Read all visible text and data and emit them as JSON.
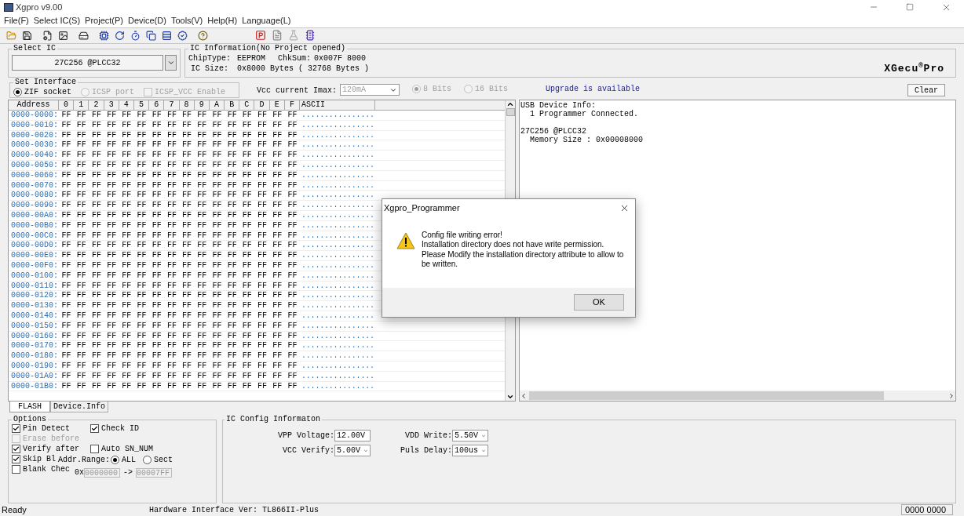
{
  "window": {
    "title": "Xgpro v9.00"
  },
  "menu": [
    "File(F)",
    "Select IC(S)",
    "Project(P)",
    "Device(D)",
    "Tools(V)",
    "Help(H)",
    "Language(L)"
  ],
  "select_ic": {
    "title": "Select IC",
    "value": "27C256 @PLCC32"
  },
  "ic_information": {
    "title": "IC Information(No Project opened)",
    "chip_type_label": "ChipType:",
    "chip_type": "EEPROM",
    "checksum_label": "ChkSum:",
    "checksum": "0x007F 8000",
    "ic_size_label": "IC Size:",
    "ic_size": "0x8000 Bytes ( 32768 Bytes )"
  },
  "logo": {
    "name": "XGecu",
    "mark": "®",
    "suffix": "Pro"
  },
  "set_interface": {
    "title": "Set Interface",
    "ports": [
      {
        "label": "ZIF socket",
        "selected": true,
        "disabled": false
      },
      {
        "label": "ICSP port",
        "selected": false,
        "disabled": true
      }
    ],
    "vcc_enable": {
      "label": "ICSP_VCC Enable",
      "checked": false,
      "disabled": true
    }
  },
  "vcc_current": {
    "label": "Vcc current Imax:",
    "value": "120mA",
    "disabled": true
  },
  "bits": [
    {
      "label": "8 Bits",
      "selected": true,
      "disabled": true
    },
    {
      "label": "16 Bits",
      "selected": false,
      "disabled": true
    }
  ],
  "upgrade_notice": "Upgrade is available",
  "clear_button": "Clear",
  "hex_table": {
    "columns": [
      "Address",
      "0",
      "1",
      "2",
      "3",
      "4",
      "5",
      "6",
      "7",
      "8",
      "9",
      "A",
      "B",
      "C",
      "D",
      "E",
      "F",
      "ASCII"
    ],
    "rows": [
      {
        "address": "0000-0000:",
        "bytes": [
          "FF",
          "FF",
          "FF",
          "FF",
          "FF",
          "FF",
          "FF",
          "FF",
          "FF",
          "FF",
          "FF",
          "FF",
          "FF",
          "FF",
          "FF",
          "FF"
        ],
        "ascii": "................"
      },
      {
        "address": "0000-0010:",
        "bytes": [
          "FF",
          "FF",
          "FF",
          "FF",
          "FF",
          "FF",
          "FF",
          "FF",
          "FF",
          "FF",
          "FF",
          "FF",
          "FF",
          "FF",
          "FF",
          "FF"
        ],
        "ascii": "................"
      },
      {
        "address": "0000-0020:",
        "bytes": [
          "FF",
          "FF",
          "FF",
          "FF",
          "FF",
          "FF",
          "FF",
          "FF",
          "FF",
          "FF",
          "FF",
          "FF",
          "FF",
          "FF",
          "FF",
          "FF"
        ],
        "ascii": "................"
      },
      {
        "address": "0000-0030:",
        "bytes": [
          "FF",
          "FF",
          "FF",
          "FF",
          "FF",
          "FF",
          "FF",
          "FF",
          "FF",
          "FF",
          "FF",
          "FF",
          "FF",
          "FF",
          "FF",
          "FF"
        ],
        "ascii": "................"
      },
      {
        "address": "0000-0040:",
        "bytes": [
          "FF",
          "FF",
          "FF",
          "FF",
          "FF",
          "FF",
          "FF",
          "FF",
          "FF",
          "FF",
          "FF",
          "FF",
          "FF",
          "FF",
          "FF",
          "FF"
        ],
        "ascii": "................"
      },
      {
        "address": "0000-0050:",
        "bytes": [
          "FF",
          "FF",
          "FF",
          "FF",
          "FF",
          "FF",
          "FF",
          "FF",
          "FF",
          "FF",
          "FF",
          "FF",
          "FF",
          "FF",
          "FF",
          "FF"
        ],
        "ascii": "................"
      },
      {
        "address": "0000-0060:",
        "bytes": [
          "FF",
          "FF",
          "FF",
          "FF",
          "FF",
          "FF",
          "FF",
          "FF",
          "FF",
          "FF",
          "FF",
          "FF",
          "FF",
          "FF",
          "FF",
          "FF"
        ],
        "ascii": "................"
      },
      {
        "address": "0000-0070:",
        "bytes": [
          "FF",
          "FF",
          "FF",
          "FF",
          "FF",
          "FF",
          "FF",
          "FF",
          "FF",
          "FF",
          "FF",
          "FF",
          "FF",
          "FF",
          "FF",
          "FF"
        ],
        "ascii": "................"
      },
      {
        "address": "0000-0080:",
        "bytes": [
          "FF",
          "FF",
          "FF",
          "FF",
          "FF",
          "FF",
          "FF",
          "FF",
          "FF",
          "FF",
          "FF",
          "FF",
          "FF",
          "FF",
          "FF",
          "FF"
        ],
        "ascii": "................"
      },
      {
        "address": "0000-0090:",
        "bytes": [
          "FF",
          "FF",
          "FF",
          "FF",
          "FF",
          "FF",
          "FF",
          "FF",
          "FF",
          "FF",
          "FF",
          "FF",
          "FF",
          "FF",
          "FF",
          "FF"
        ],
        "ascii": "................"
      },
      {
        "address": "0000-00A0:",
        "bytes": [
          "FF",
          "FF",
          "FF",
          "FF",
          "FF",
          "FF",
          "FF",
          "FF",
          "FF",
          "FF",
          "FF",
          "FF",
          "FF",
          "FF",
          "FF",
          "FF"
        ],
        "ascii": "................"
      },
      {
        "address": "0000-00B0:",
        "bytes": [
          "FF",
          "FF",
          "FF",
          "FF",
          "FF",
          "FF",
          "FF",
          "FF",
          "FF",
          "FF",
          "FF",
          "FF",
          "FF",
          "FF",
          "FF",
          "FF"
        ],
        "ascii": "................"
      },
      {
        "address": "0000-00C0:",
        "bytes": [
          "FF",
          "FF",
          "FF",
          "FF",
          "FF",
          "FF",
          "FF",
          "FF",
          "FF",
          "FF",
          "FF",
          "FF",
          "FF",
          "FF",
          "FF",
          "FF"
        ],
        "ascii": "................"
      },
      {
        "address": "0000-00D0:",
        "bytes": [
          "FF",
          "FF",
          "FF",
          "FF",
          "FF",
          "FF",
          "FF",
          "FF",
          "FF",
          "FF",
          "FF",
          "FF",
          "FF",
          "FF",
          "FF",
          "FF"
        ],
        "ascii": "................"
      },
      {
        "address": "0000-00E0:",
        "bytes": [
          "FF",
          "FF",
          "FF",
          "FF",
          "FF",
          "FF",
          "FF",
          "FF",
          "FF",
          "FF",
          "FF",
          "FF",
          "FF",
          "FF",
          "FF",
          "FF"
        ],
        "ascii": "................"
      },
      {
        "address": "0000-00F0:",
        "bytes": [
          "FF",
          "FF",
          "FF",
          "FF",
          "FF",
          "FF",
          "FF",
          "FF",
          "FF",
          "FF",
          "FF",
          "FF",
          "FF",
          "FF",
          "FF",
          "FF"
        ],
        "ascii": "................"
      },
      {
        "address": "0000-0100:",
        "bytes": [
          "FF",
          "FF",
          "FF",
          "FF",
          "FF",
          "FF",
          "FF",
          "FF",
          "FF",
          "FF",
          "FF",
          "FF",
          "FF",
          "FF",
          "FF",
          "FF"
        ],
        "ascii": "................"
      },
      {
        "address": "0000-0110:",
        "bytes": [
          "FF",
          "FF",
          "FF",
          "FF",
          "FF",
          "FF",
          "FF",
          "FF",
          "FF",
          "FF",
          "FF",
          "FF",
          "FF",
          "FF",
          "FF",
          "FF"
        ],
        "ascii": "................"
      },
      {
        "address": "0000-0120:",
        "bytes": [
          "FF",
          "FF",
          "FF",
          "FF",
          "FF",
          "FF",
          "FF",
          "FF",
          "FF",
          "FF",
          "FF",
          "FF",
          "FF",
          "FF",
          "FF",
          "FF"
        ],
        "ascii": "................"
      },
      {
        "address": "0000-0130:",
        "bytes": [
          "FF",
          "FF",
          "FF",
          "FF",
          "FF",
          "FF",
          "FF",
          "FF",
          "FF",
          "FF",
          "FF",
          "FF",
          "FF",
          "FF",
          "FF",
          "FF"
        ],
        "ascii": "................"
      },
      {
        "address": "0000-0140:",
        "bytes": [
          "FF",
          "FF",
          "FF",
          "FF",
          "FF",
          "FF",
          "FF",
          "FF",
          "FF",
          "FF",
          "FF",
          "FF",
          "FF",
          "FF",
          "FF",
          "FF"
        ],
        "ascii": "................"
      },
      {
        "address": "0000-0150:",
        "bytes": [
          "FF",
          "FF",
          "FF",
          "FF",
          "FF",
          "FF",
          "FF",
          "FF",
          "FF",
          "FF",
          "FF",
          "FF",
          "FF",
          "FF",
          "FF",
          "FF"
        ],
        "ascii": "................"
      },
      {
        "address": "0000-0160:",
        "bytes": [
          "FF",
          "FF",
          "FF",
          "FF",
          "FF",
          "FF",
          "FF",
          "FF",
          "FF",
          "FF",
          "FF",
          "FF",
          "FF",
          "FF",
          "FF",
          "FF"
        ],
        "ascii": "................"
      },
      {
        "address": "0000-0170:",
        "bytes": [
          "FF",
          "FF",
          "FF",
          "FF",
          "FF",
          "FF",
          "FF",
          "FF",
          "FF",
          "FF",
          "FF",
          "FF",
          "FF",
          "FF",
          "FF",
          "FF"
        ],
        "ascii": "................"
      },
      {
        "address": "0000-0180:",
        "bytes": [
          "FF",
          "FF",
          "FF",
          "FF",
          "FF",
          "FF",
          "FF",
          "FF",
          "FF",
          "FF",
          "FF",
          "FF",
          "FF",
          "FF",
          "FF",
          "FF"
        ],
        "ascii": "................"
      },
      {
        "address": "0000-0190:",
        "bytes": [
          "FF",
          "FF",
          "FF",
          "FF",
          "FF",
          "FF",
          "FF",
          "FF",
          "FF",
          "FF",
          "FF",
          "FF",
          "FF",
          "FF",
          "FF",
          "FF"
        ],
        "ascii": "................"
      },
      {
        "address": "0000-01A0:",
        "bytes": [
          "FF",
          "FF",
          "FF",
          "FF",
          "FF",
          "FF",
          "FF",
          "FF",
          "FF",
          "FF",
          "FF",
          "FF",
          "FF",
          "FF",
          "FF",
          "FF"
        ],
        "ascii": "................"
      },
      {
        "address": "0000-01B0:",
        "bytes": [
          "FF",
          "FF",
          "FF",
          "FF",
          "FF",
          "FF",
          "FF",
          "FF",
          "FF",
          "FF",
          "FF",
          "FF",
          "FF",
          "FF",
          "FF",
          "FF"
        ],
        "ascii": "................"
      }
    ]
  },
  "log": [
    {
      "text": "USB Device Info:",
      "children": [
        {
          "text": "1  Programmer Connected."
        }
      ]
    },
    {
      "text": "27C256 @PLCC32",
      "children": [
        {
          "text": "Memory Size : 0x00008000"
        }
      ]
    }
  ],
  "bottom_tabs": [
    {
      "label": "FLASH",
      "selected": true
    },
    {
      "label": "Device.Info",
      "selected": false
    }
  ],
  "options": {
    "title": "Options",
    "left": [
      {
        "label": "Pin Detect",
        "checked": true,
        "disabled": false
      },
      {
        "label": "Erase before",
        "checked": false,
        "disabled": true
      },
      {
        "label": "Verify after",
        "checked": true,
        "disabled": false
      },
      {
        "label": "Skip Bl",
        "checked": true,
        "disabled": false
      },
      {
        "label": "Blank Chec",
        "checked": false,
        "disabled": false
      }
    ],
    "right": [
      {
        "label": "Check ID",
        "checked": true,
        "disabled": false
      },
      {
        "label": "Auto SN_NUM",
        "checked": false,
        "disabled": false
      }
    ],
    "addr_range": {
      "label": "Addr.Range:",
      "choices": [
        {
          "label": "ALL",
          "selected": true
        },
        {
          "label": "Sect",
          "selected": false
        }
      ],
      "prefix": "0x",
      "start": "0000000",
      "arrow": "->",
      "end": "00007FF"
    }
  },
  "ic_config": {
    "title": "IC Config Informaton",
    "fields": [
      {
        "label": "VPP Voltage:",
        "value": "12.00V"
      },
      {
        "label": "VDD Write:",
        "value": "5.50V"
      },
      {
        "label": "VCC Verify:",
        "value": "5.00V"
      },
      {
        "label": "Puls Delay:",
        "value": "100us"
      }
    ]
  },
  "status_bar": {
    "status": "Ready",
    "hardware": "Hardware Interface Ver: TL866II-Plus",
    "counter": "0000 0000"
  },
  "dialog": {
    "title": "Xgpro_Programmer",
    "lines": [
      "Config file writing error!",
      "Installation directory does not have write permission.",
      "Please Modify the installation directory attribute to allow to be written."
    ],
    "button": "OK"
  }
}
